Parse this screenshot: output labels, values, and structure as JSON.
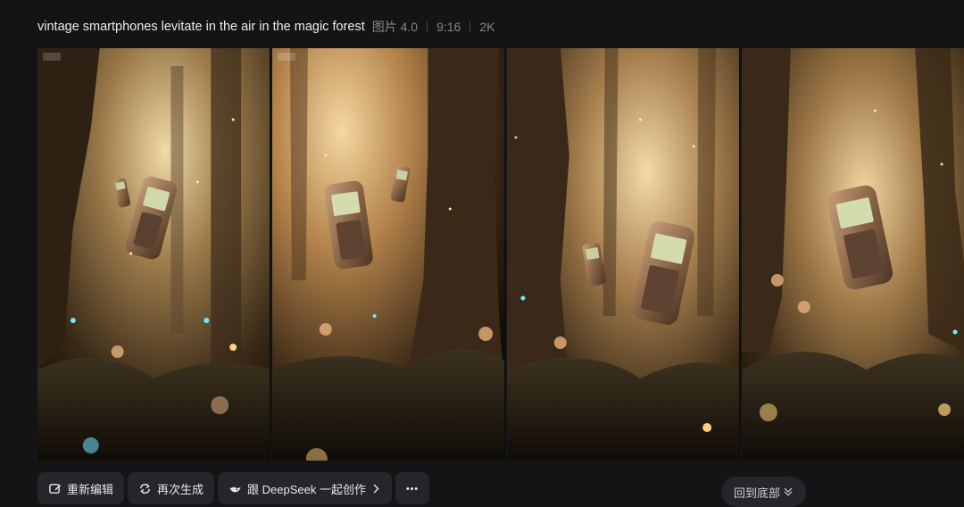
{
  "header": {
    "prompt": "vintage smartphones levitate in the air in the magic forest",
    "model": "图片 4.0",
    "ratio": "9:16",
    "resolution": "2K"
  },
  "gallery": {
    "images": [
      {
        "subject": "two vintage phones floating beside mossy tree trunk"
      },
      {
        "subject": "two vintage phones floating in golden forest light"
      },
      {
        "subject": "two vintage phones floating near sunlit tree"
      },
      {
        "subject": "one vintage phone floating in glowing forest"
      }
    ]
  },
  "toolbar": {
    "reedit_label": "重新编辑",
    "regenerate_label": "再次生成",
    "deepseek_label": "跟 DeepSeek 一起创作",
    "more_label": "···"
  },
  "scroll": {
    "label": "回到底部"
  },
  "colors": {
    "background": "#141416",
    "button_bg": "#25262a",
    "meta_text": "#86868c",
    "glow": "#ffd27a",
    "cyan_glow": "#6fe8ff"
  }
}
